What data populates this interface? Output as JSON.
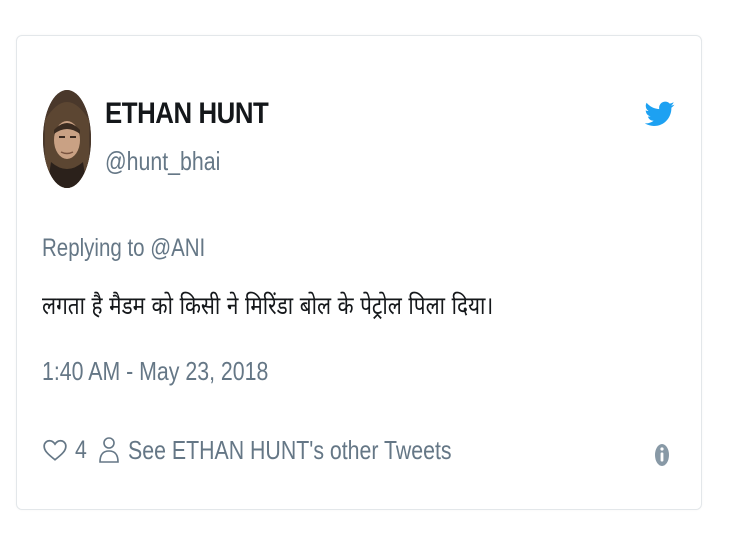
{
  "user": {
    "display_name": "ETHAN HUNT",
    "handle": "@hunt_bhai"
  },
  "reply": {
    "prefix": "Replying to ",
    "mention": "@ANI"
  },
  "tweet": {
    "text": "लगता है मैडम को किसी ने मिरिंडा बोल के पेट्रोल पिला दिया।",
    "timestamp": "1:40 AM - May 23, 2018"
  },
  "actions": {
    "like_count": "4",
    "other_tweets_label": "See ETHAN HUNT's other Tweets"
  },
  "icons": {
    "brand": "twitter-bird-icon",
    "like": "heart-icon",
    "profile": "person-icon",
    "info": "info-icon"
  },
  "colors": {
    "twitter_blue": "#1da1f2",
    "text_primary": "#14171a",
    "text_secondary": "#657786",
    "border": "#e3e7ea"
  }
}
